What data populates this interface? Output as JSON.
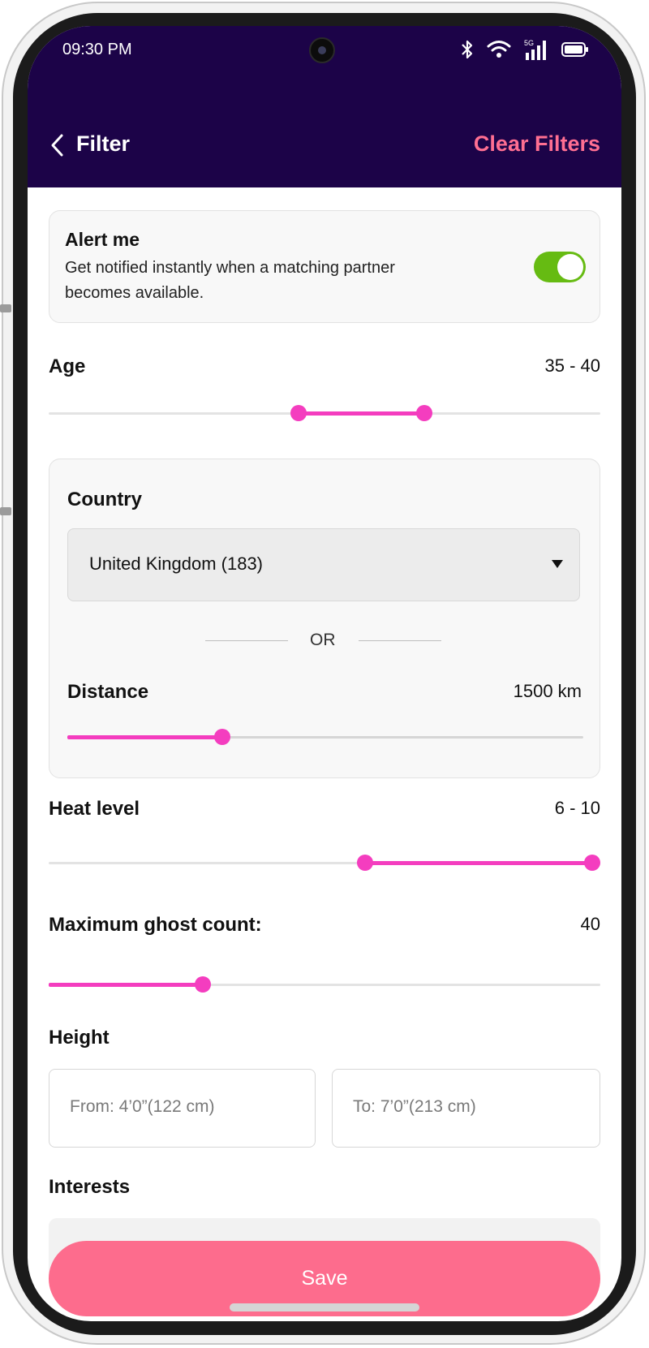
{
  "status": {
    "time": "09:30 PM",
    "icons": [
      "bluetooth-icon",
      "wifi-icon",
      "5g-signal-icon",
      "battery-icon"
    ],
    "network": "5G"
  },
  "header": {
    "title": "Filter",
    "clear_label": "Clear Filters",
    "back_icon": "chevron-left-icon"
  },
  "alert": {
    "title": "Alert me",
    "description_line1": "Get notified instantly when a matching partner",
    "description_line2": "becomes available.",
    "enabled": true
  },
  "age": {
    "label": "Age",
    "value": "35 - 40"
  },
  "country": {
    "label": "Country",
    "selected": "United Kingdom (183)",
    "or_text": "OR"
  },
  "distance": {
    "label": "Distance",
    "value": "1500 km"
  },
  "heat": {
    "label": "Heat level",
    "value": "6 - 10"
  },
  "ghost": {
    "label": "Maximum ghost count:",
    "value": "40"
  },
  "height": {
    "label": "Height",
    "from_placeholder": "From: 4’0”(122 cm)",
    "to_placeholder": "To: 7’0”(213 cm)"
  },
  "interests": {
    "label": "Interests"
  },
  "footer": {
    "save_label": "Save"
  },
  "colors": {
    "header_bg": "#1c0348",
    "accent_pink": "#f43dbf",
    "clear_pink": "#ff6f92",
    "save_pink": "#fd6c8d",
    "toggle_green": "#66bb12"
  }
}
